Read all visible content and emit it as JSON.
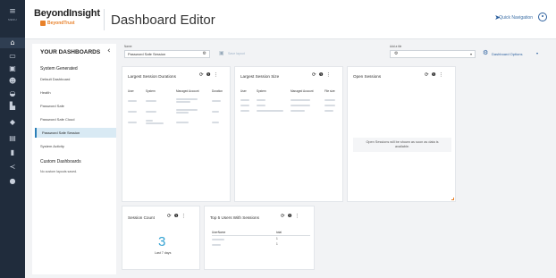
{
  "rail": {
    "menu_label": "MENU",
    "icons": [
      "home-icon",
      "monitor-icon",
      "clipboard-icon",
      "users-icon",
      "wifi-icon",
      "dashboard-icon",
      "shield-icon",
      "asset-icon",
      "chart-icon",
      "share-icon",
      "info-icon"
    ]
  },
  "header": {
    "brand": "BeyondInsight",
    "brand_sub": "BeyondTrust",
    "title": "Dashboard Editor",
    "quick_nav": "Quick Navigation"
  },
  "sidebar": {
    "title": "YOUR DASHBOARDS",
    "system_section": "System Generated",
    "system_items": [
      {
        "label": "Default Dashboard"
      },
      {
        "label": "Health"
      },
      {
        "label": "Password Safe"
      },
      {
        "label": "Password Safe Cloud"
      },
      {
        "label": "Password Safe Session"
      },
      {
        "label": "System Activity"
      }
    ],
    "custom_section": "Custom Dashboards",
    "custom_note": "No custom layouts saved."
  },
  "toolbar": {
    "name_label": "Name",
    "name_value": "Password Safe Session",
    "save_label": "Save layout",
    "add_tile_label": "Add a tile",
    "add_tile_placeholder": "",
    "options_label": "Dashboard Options"
  },
  "cards": {
    "durations": {
      "title": "Largest Session Durations",
      "columns": [
        "User",
        "System",
        "Managed Account",
        "Duration"
      ]
    },
    "size": {
      "title": "Largest Session Size",
      "columns": [
        "User",
        "System",
        "Managed Account",
        "File size"
      ]
    },
    "open": {
      "title": "Open Sessions",
      "message": "Open Sessions will be shown as soon as data is available."
    },
    "count": {
      "title": "Session Count",
      "value": "3",
      "period": "Last 7 days"
    },
    "top5": {
      "title": "Top 5 Users With Sessions",
      "columns": [
        "UserName",
        "total"
      ],
      "totals": [
        "1",
        "1"
      ]
    }
  },
  "colors": {
    "rail": "#202c3c",
    "accent": "#2b5f9e",
    "brand_orange": "#e8812a",
    "highlight": "#35a3d3"
  }
}
